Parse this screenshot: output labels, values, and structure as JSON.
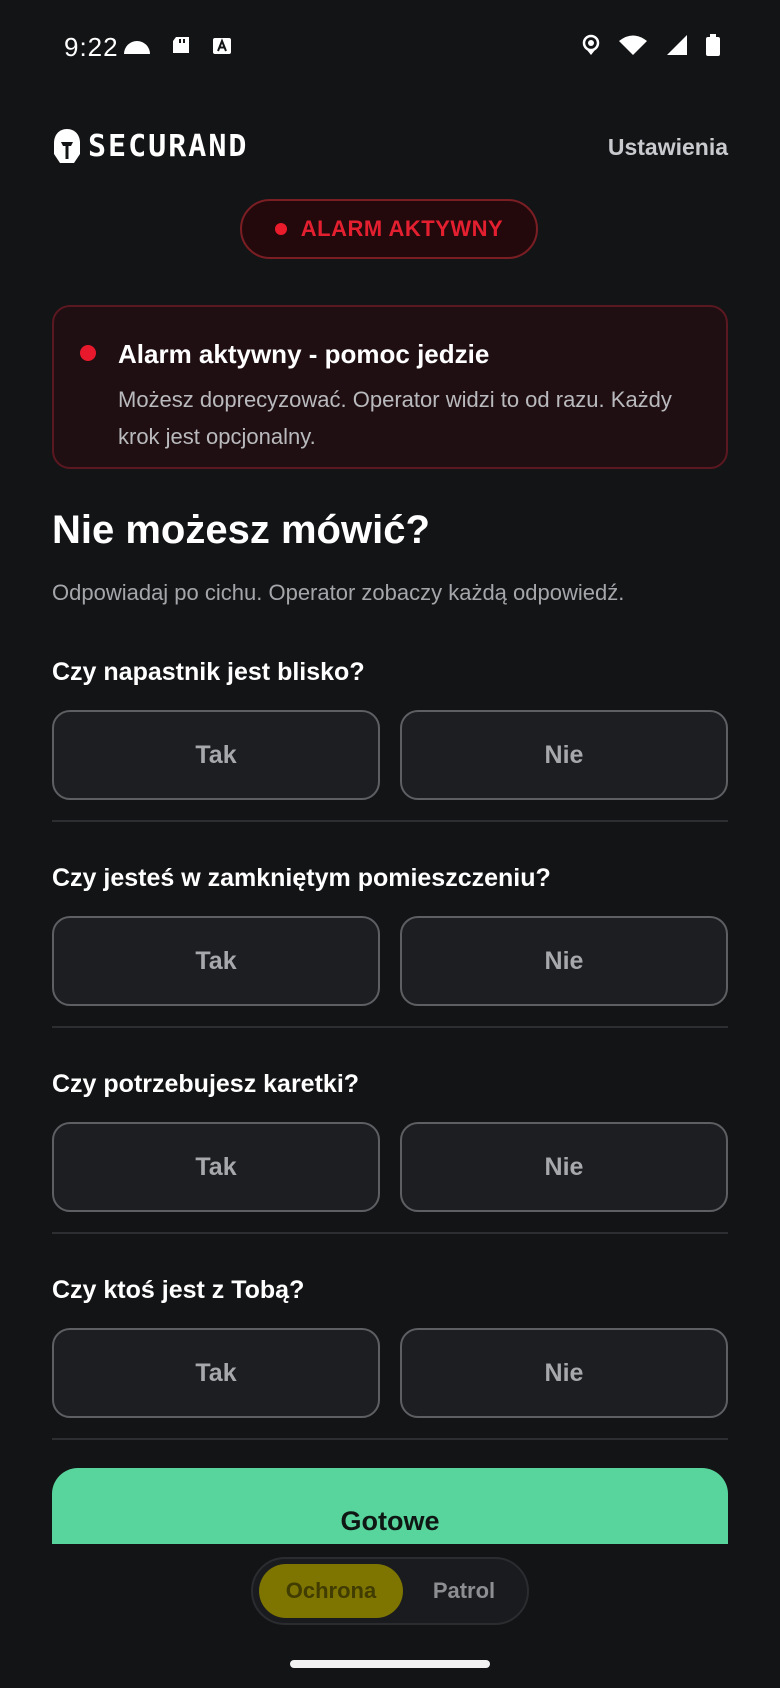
{
  "status_bar": {
    "time": "9:22"
  },
  "header": {
    "logo_text": "SECURAND",
    "settings_label": "Ustawienia"
  },
  "alarm_pill": {
    "label": "ALARM AKTYWNY"
  },
  "alert_card": {
    "title": "Alarm aktywny - pomoc jedzie",
    "text": "Możesz doprecyzować. Operator widzi to od razu. Każdy krok jest opcjonalny."
  },
  "page": {
    "title": "Nie możesz mówić?",
    "subtitle": "Odpowiadaj po cichu. Operator zobaczy każdą odpowiedź."
  },
  "questions": [
    {
      "label": "Czy napastnik jest blisko?",
      "yes": "Tak",
      "no": "Nie"
    },
    {
      "label": "Czy jesteś w zamkniętym pomieszczeniu?",
      "yes": "Tak",
      "no": "Nie"
    },
    {
      "label": "Czy potrzebujesz karetki?",
      "yes": "Tak",
      "no": "Nie"
    },
    {
      "label": "Czy ktoś jest z Tobą?",
      "yes": "Tak",
      "no": "Nie"
    }
  ],
  "done_button": {
    "label": "Gotowe"
  },
  "mode_switch": {
    "active": "Ochrona",
    "inactive": "Patrol"
  },
  "colors": {
    "background": "#131416",
    "alarm_red": "#e41f2f",
    "done_green": "#57d59c",
    "mode_active": "#7d7500"
  }
}
